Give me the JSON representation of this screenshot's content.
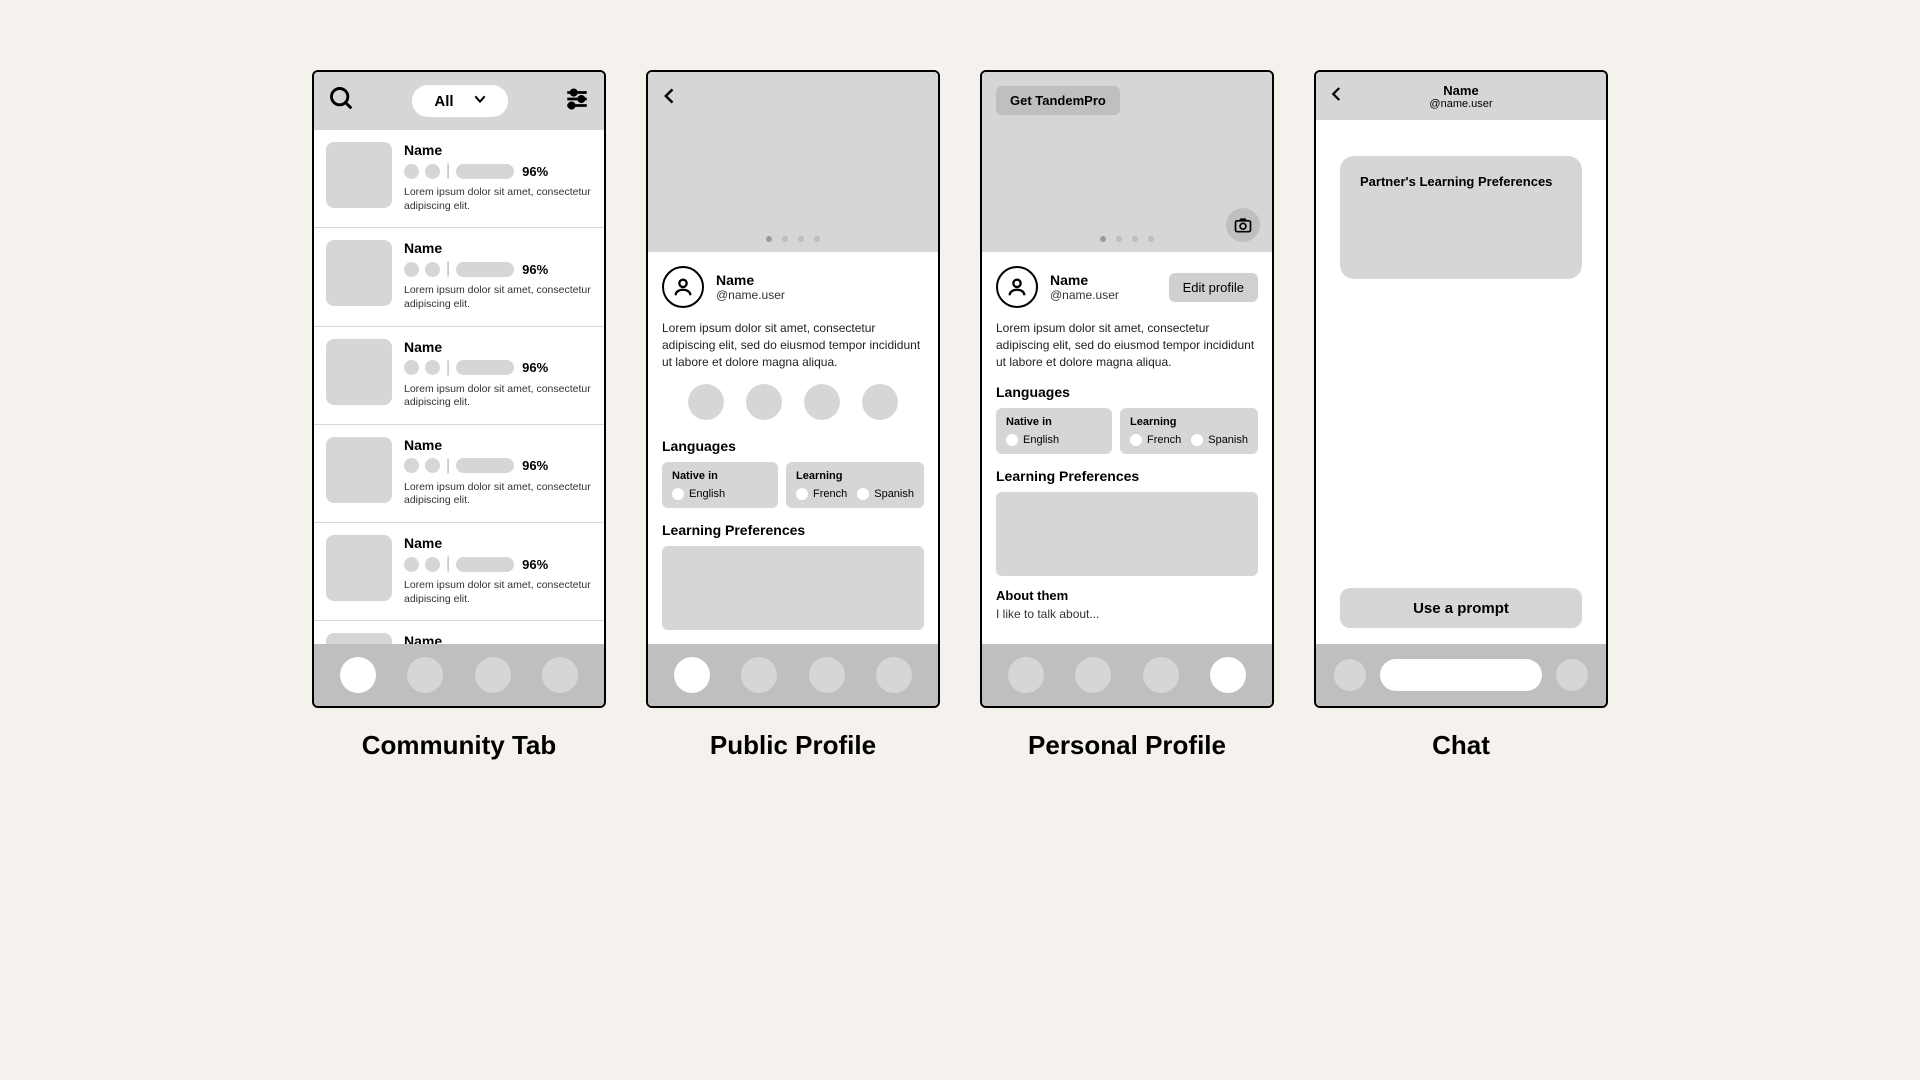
{
  "captions": {
    "community": "Community Tab",
    "public": "Public Profile",
    "personal": "Personal Profile",
    "chat": "Chat"
  },
  "community": {
    "filter_label": "All",
    "rows": [
      {
        "name": "Name",
        "pct": "96%",
        "desc": "Lorem ipsum dolor sit amet, consectetur adipiscing elit."
      },
      {
        "name": "Name",
        "pct": "96%",
        "desc": "Lorem ipsum dolor sit amet, consectetur adipiscing elit."
      },
      {
        "name": "Name",
        "pct": "96%",
        "desc": "Lorem ipsum dolor sit amet, consectetur adipiscing elit."
      },
      {
        "name": "Name",
        "pct": "96%",
        "desc": "Lorem ipsum dolor sit amet, consectetur adipiscing elit."
      },
      {
        "name": "Name",
        "pct": "96%",
        "desc": "Lorem ipsum dolor sit amet, consectetur adipiscing elit."
      },
      {
        "name": "Name",
        "pct": "",
        "desc": ""
      }
    ]
  },
  "public_profile": {
    "name": "Name",
    "handle": "@name.user",
    "bio": "Lorem ipsum dolor sit amet, consectetur adipiscing elit, sed do eiusmod tempor incididunt ut labore et dolore magna aliqua.",
    "languages_label": "Languages",
    "native_label": "Native in",
    "native_items": [
      "English"
    ],
    "learning_label": "Learning",
    "learning_items": [
      "French",
      "Spanish"
    ],
    "prefs_label": "Learning Preferences"
  },
  "personal_profile": {
    "pro_cta": "Get TandemPro",
    "name": "Name",
    "handle": "@name.user",
    "edit_label": "Edit profile",
    "bio": "Lorem ipsum dolor sit amet, consectetur adipiscing elit, sed do eiusmod tempor incididunt ut labore et dolore magna aliqua.",
    "languages_label": "Languages",
    "native_label": "Native in",
    "native_items": [
      "English"
    ],
    "learning_label": "Learning",
    "learning_items": [
      "French",
      "Spanish"
    ],
    "prefs_label": "Learning Preferences",
    "about_label": "About them",
    "about_text": "I like to talk about..."
  },
  "chat": {
    "name": "Name",
    "handle": "@name.user",
    "bubble": "Partner's Learning Preferences",
    "prompt_cta": "Use a prompt"
  }
}
